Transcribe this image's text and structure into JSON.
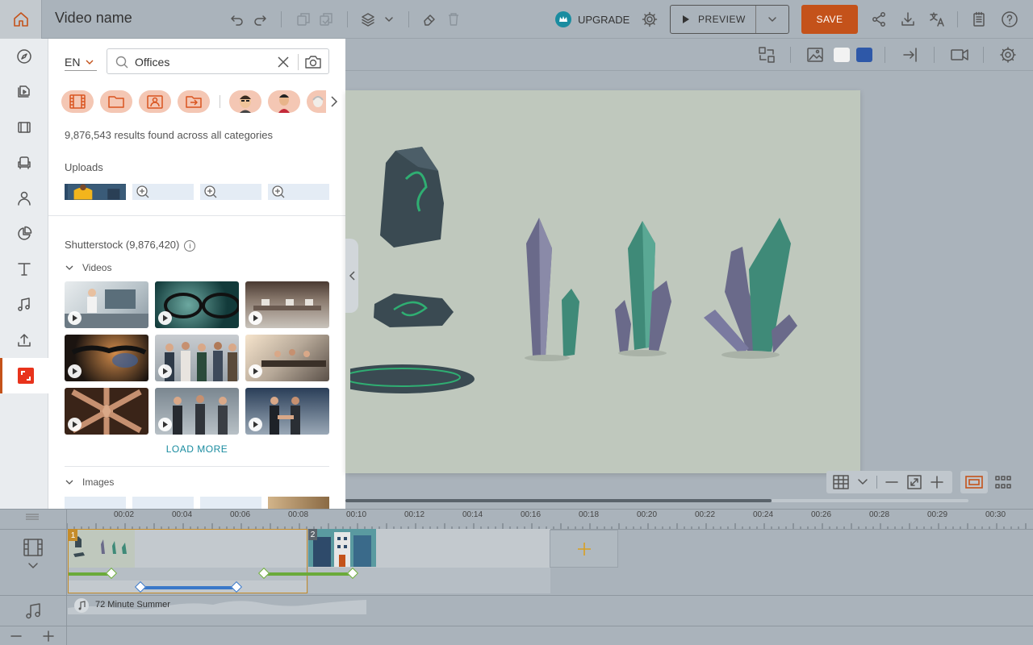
{
  "header": {
    "video_name": "Video name",
    "upgrade_label": "UPGRADE",
    "preview_label": "PREVIEW",
    "save_label": "SAVE"
  },
  "sidebar": {
    "items": [
      {
        "icon": "compass-icon"
      },
      {
        "icon": "video-file-icon"
      },
      {
        "icon": "film-icon"
      },
      {
        "icon": "armchair-icon"
      },
      {
        "icon": "person-icon"
      },
      {
        "icon": "pie-chart-icon"
      },
      {
        "icon": "text-icon"
      },
      {
        "icon": "music-icon"
      },
      {
        "icon": "upload-icon"
      },
      {
        "icon": "shutterstock-icon",
        "active": true
      }
    ]
  },
  "library": {
    "language": "EN",
    "search_value": "Offices",
    "results_text": "9,876,543 results found across all categories",
    "uploads_title": "Uploads",
    "shutterstock_title": "Shutterstock (9,876,420)",
    "info_glyph": "i",
    "videos_label": "Videos",
    "load_more_label": "LOAD MORE",
    "images_label": "Images"
  },
  "timeline": {
    "ticks": [
      "00:02",
      "00:04",
      "00:06",
      "00:08",
      "00:10",
      "00:12",
      "00:14",
      "00:16",
      "00:18",
      "00:20",
      "00:22",
      "00:24",
      "00:26",
      "00:28",
      "00:29",
      "00:30"
    ],
    "scene_numbers": [
      "1",
      "2"
    ],
    "audio_track": "72 Minute Summer"
  },
  "colors": {
    "accent": "#c4521a",
    "link": "#1a8ca0",
    "scene_border": "#c58c2a",
    "swatch_white": "#f2f2f2",
    "swatch_blue": "#2e58a8"
  }
}
